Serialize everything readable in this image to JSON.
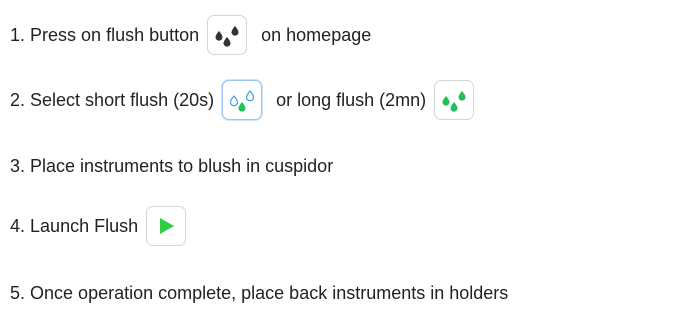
{
  "steps": [
    {
      "number": "1.",
      "text_before": "Press on flush button",
      "text_after": "on homepage"
    },
    {
      "number": "2.",
      "text_before": "Select short flush (20s)",
      "text_middle": "or long flush (2mn)"
    },
    {
      "number": "3.",
      "text": "Place instruments to blush in cuspidor"
    },
    {
      "number": "4.",
      "text": "Launch Flush"
    },
    {
      "number": "5.",
      "text": "Once operation complete, place back instruments in holders"
    }
  ],
  "icons": {
    "flush": "flush-drops-icon",
    "short_flush": "short-flush-icon",
    "long_flush": "long-flush-icon",
    "play": "play-icon"
  },
  "colors": {
    "drop_dark": "#333333",
    "drop_green": "#22c05a",
    "drop_outline": "#3aa0e6",
    "play_green": "#2ecc40"
  }
}
